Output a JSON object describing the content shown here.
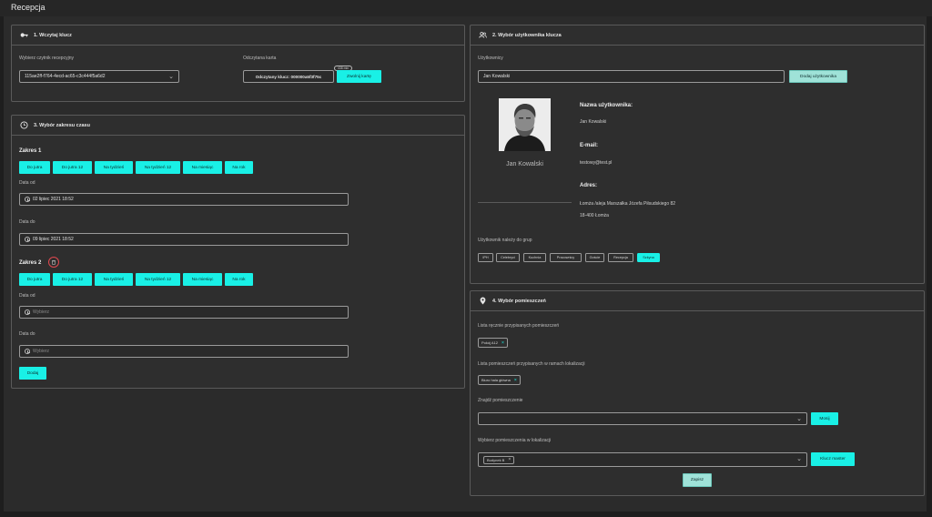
{
  "app": {
    "title": "Recepcja"
  },
  "panels": {
    "key": {
      "title": "1. Wczytaj klucz",
      "reader_label": "Wybierz czytnik recepcyjny",
      "reader_value": "115ae2ff-f764-4ecd-ac65-c3c444f5a6d2",
      "card_label": "Odczytana karta",
      "card_value": "Odczytany klucz: 000000a5f3f75c",
      "card_badge": "438 min",
      "release_button": "Zwolnij kartę"
    },
    "time": {
      "title": "3. Wybór zakresu czasu",
      "range1": {
        "title": "Zakres 1",
        "buttons": [
          "Do jutra",
          "Do jutra 12",
          "Na tydzień",
          "Na tydzień 12",
          "Na miesiąc",
          "Na rok"
        ],
        "from_label": "Data od",
        "from_value": "02 lipiec 2021 18:52",
        "to_label": "Data do",
        "to_value": "09 lipiec 2021 18:52"
      },
      "range2": {
        "title": "Zakres 2",
        "buttons": [
          "Do jutra",
          "Do jutra 12",
          "Na tydzień",
          "Na tydzień 12",
          "Na miesiąc",
          "Na rok"
        ],
        "from_label": "Data od",
        "from_placeholder": "Wybierz",
        "to_label": "Data do",
        "to_placeholder": "Wybierz"
      },
      "add_button": "Dodaj"
    },
    "user": {
      "title": "2. Wybór użytkownika klucza",
      "users_label": "Użytkownicy",
      "users_value": "Jan Kowalski",
      "add_user_button": "Dodaj użytkownika",
      "card_name": "Jan Kowalski",
      "name_heading": "Nazwa użytkownika:",
      "name_value": "Jan Kowalski",
      "email_heading": "E-mail:",
      "email_value": "testowy@test.pl",
      "address_heading": "Adres:",
      "address_line1": "Łomża /aleja Marszałka Józefa Piłsudskiego 82",
      "address_line2": "18-400 Łomża",
      "groups_label": "Użytkownik należy do grup",
      "groups": [
        "IPH",
        "Celebryci",
        "Kuchnia",
        "Pracownicy",
        "Goście",
        "Recepcja",
        "Szkyna"
      ]
    },
    "rooms": {
      "title": "4. Wybór pomieszczeń",
      "manual_label": "Lista ręcznie przypisanych pomieszczeń",
      "manual_tags": [
        "Pokój A12"
      ],
      "location_label": "Lista pomieszczeń przypisanych w ramach lokalizacji",
      "location_tags": [
        "Biuro hala główna"
      ],
      "find_label": "Znajdź pomieszczenie",
      "find_value": "",
      "find_button": "Mosij",
      "choose_label": "Wybierz pomieszczenia w lokalizacji",
      "choose_tags": [
        "Budynek B"
      ],
      "master_button": "Klucz master",
      "save_button": "Zapisz"
    }
  },
  "colors": {
    "accent": "#19f0e6",
    "background": "#2b2b2b",
    "panel": "#2e2e2e",
    "border": "#5a5a5a"
  }
}
